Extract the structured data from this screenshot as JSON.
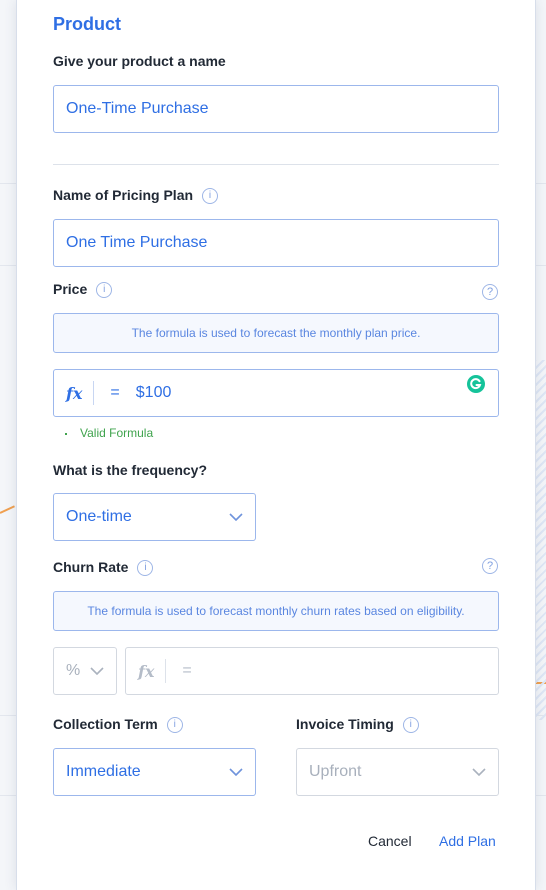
{
  "form": {
    "section_title": "Product",
    "product_name_label": "Give your product a name",
    "product_name_value": "One-Time Purchase",
    "pricing_plan_label": "Name of Pricing Plan",
    "pricing_plan_value": "One Time Purchase",
    "price_label": "Price",
    "price_note": "The formula is used to forecast the monthly plan price.",
    "price_fx_symbol": "fx",
    "price_equals": "=",
    "price_formula_value": "$100",
    "price_validation": "Valid Formula",
    "frequency_label": "What is the frequency?",
    "frequency_value": "One-time",
    "churn_label": "Churn Rate",
    "churn_note": "The formula is used to forecast monthly churn rates based on eligibility.",
    "churn_unit": "%",
    "churn_fx_symbol": "fx",
    "churn_equals": "=",
    "collection_label": "Collection Term",
    "collection_value": "Immediate",
    "invoice_label": "Invoice Timing",
    "invoice_value": "Upfront",
    "info_glyph": "i",
    "help_glyph": "?"
  },
  "actions": {
    "cancel_label": "Cancel",
    "add_label": "Add Plan"
  },
  "colors": {
    "accent": "#2f6fe4",
    "label": "#222a36",
    "valid": "#3fa34d",
    "grammarly": "#15c39a"
  },
  "icons": [
    "info-icon",
    "help-icon",
    "fx-icon",
    "chevron-down-icon",
    "grammarly-icon"
  ]
}
